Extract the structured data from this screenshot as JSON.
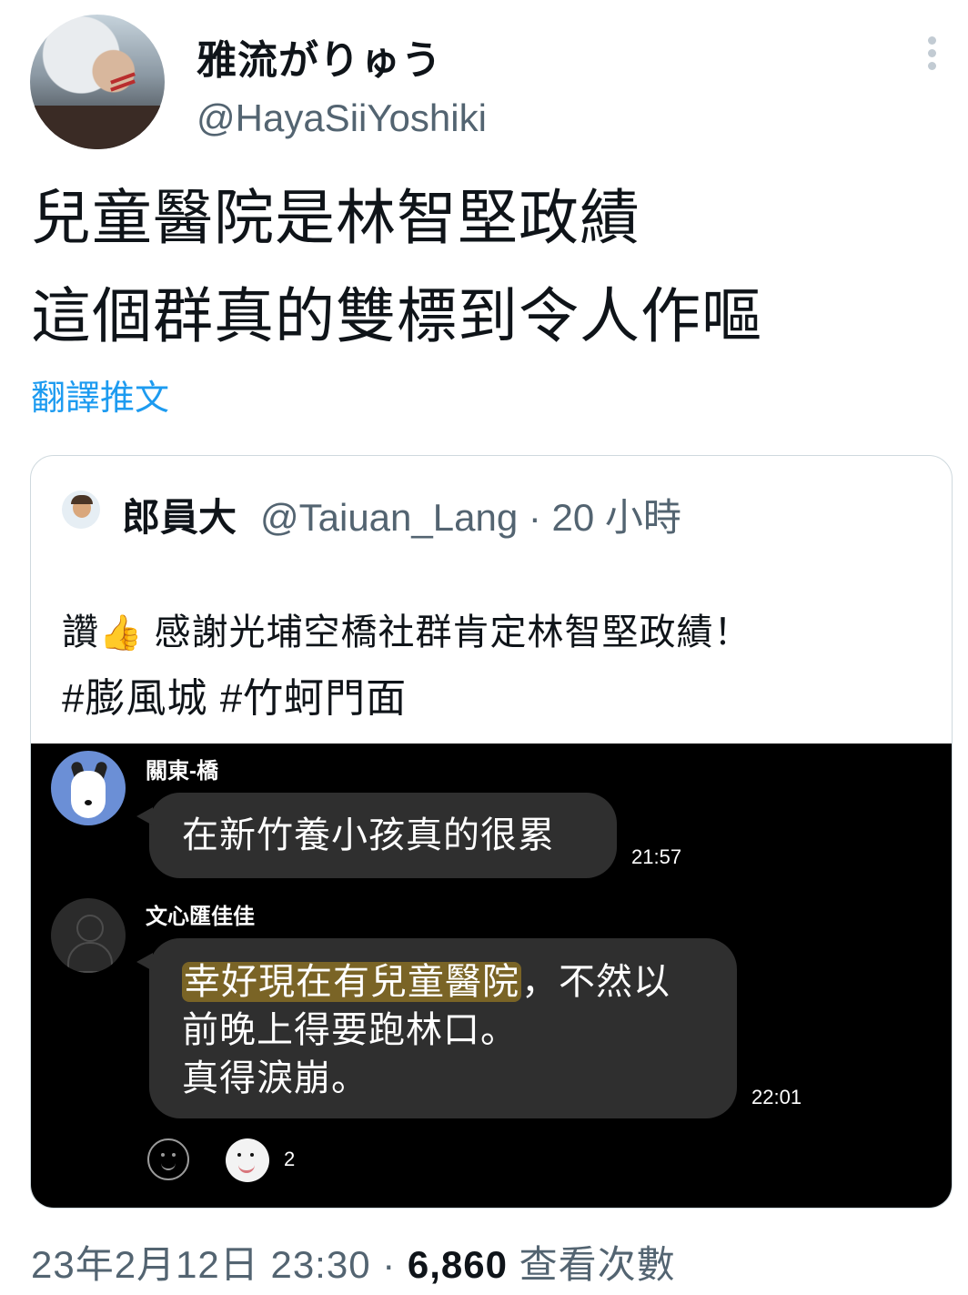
{
  "author": {
    "name": "雅流がりゅう",
    "handle": "@HayaSiiYoshiki"
  },
  "tweet": {
    "line1": "兒童醫院是林智堅政績",
    "line2": "這個群真的雙標到令人作嘔",
    "translate_label": "翻譯推文"
  },
  "quote": {
    "name": "郎員大",
    "meta": "@Taiuan_Lang · 20 小時",
    "text_prefix": "讚",
    "thumb_emoji": "👍",
    "text_body": "感謝光埔空橋社群肯定林智堅政績！",
    "tags": "#膨風城 #竹蚵門面"
  },
  "chat": {
    "message1": {
      "sender": "關東-橋",
      "text": "在新竹養小孩真的很累",
      "time": "21:57"
    },
    "message2": {
      "sender": "文心匯佳佳",
      "highlight_text": "幸好現在有兒童醫院",
      "text_after_highlight": "，不然以",
      "line2": "前晚上得要跑林口。",
      "line3": "真得淚崩。",
      "time": "22:01"
    },
    "reaction_count": "2"
  },
  "footer": {
    "date_time": "23年2月12日 23:30",
    "separator": " · ",
    "views_count": "6,860",
    "views_label": " 查看次數"
  }
}
